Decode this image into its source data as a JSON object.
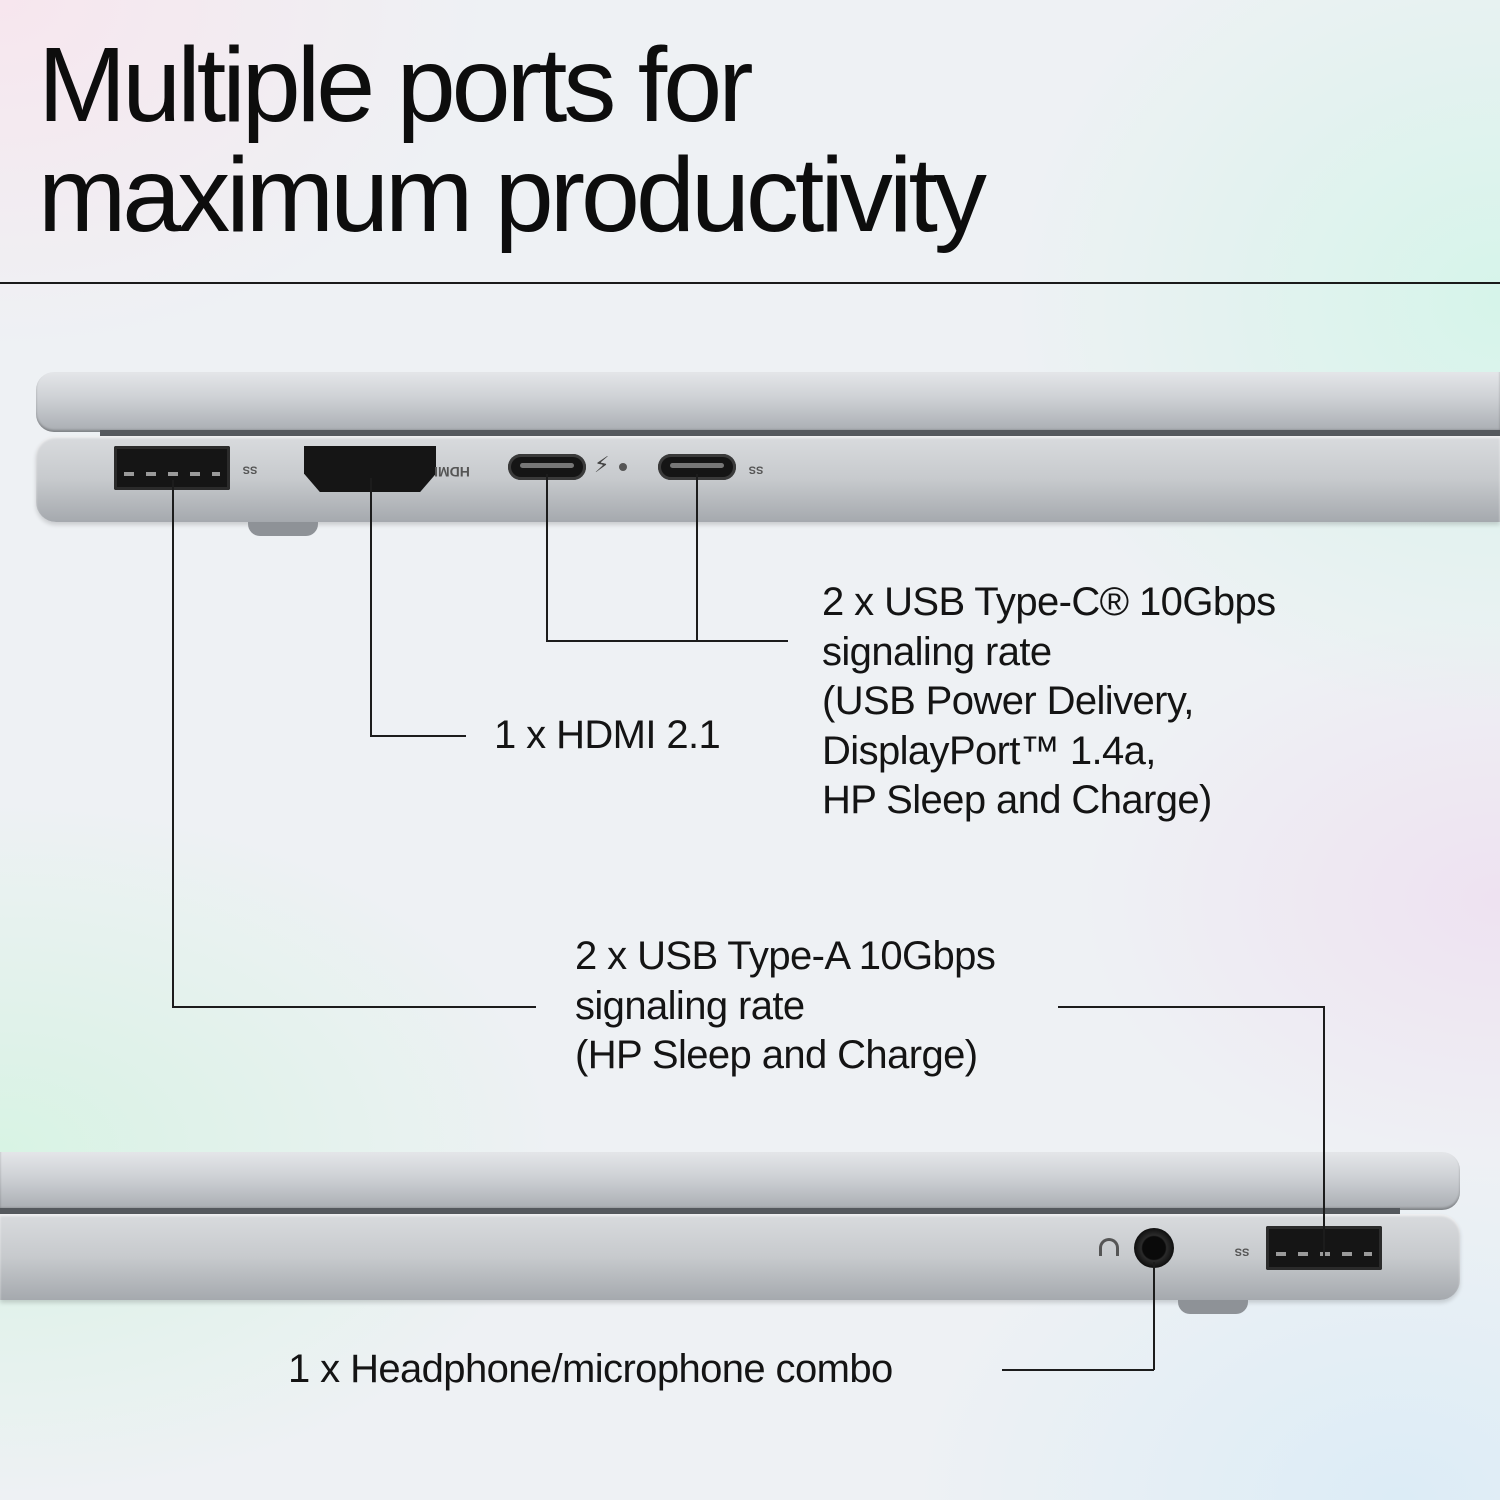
{
  "title": {
    "line1": "Multiple ports for",
    "line2": "maximum productivity"
  },
  "callouts": {
    "usb_c": {
      "line1": "2 x USB Type-C® 10Gbps",
      "line2": "signaling rate",
      "line3": "(USB Power Delivery,",
      "line4": "DisplayPort™ 1.4a,",
      "line5": "HP Sleep and Charge)"
    },
    "hdmi": {
      "line1": "1 x HDMI 2.1"
    },
    "usb_a": {
      "line1": "2 x USB Type-A 10Gbps",
      "line2": "signaling rate",
      "line3": "(HP Sleep and Charge)"
    },
    "audio": {
      "line1": "1 x Headphone/microphone combo"
    }
  },
  "port_markings": {
    "hdmi_text": "HDMI",
    "ss": "SS"
  },
  "icons": [
    "usb-a-port-icon",
    "hdmi-port-icon",
    "thunderbolt-icon",
    "usb-c-port-icon",
    "headphone-icon",
    "audio-jack-icon"
  ],
  "colors": {
    "text": "#141414",
    "laptop_silver": "#c7cacd",
    "port_black": "#151515"
  }
}
